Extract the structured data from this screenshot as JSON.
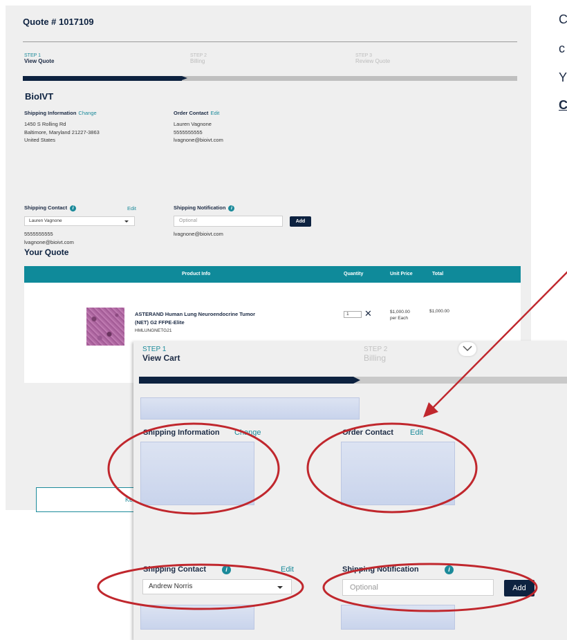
{
  "quote": {
    "title": "Quote # 1017109",
    "steps": [
      {
        "num": "STEP 1",
        "label": "View Quote"
      },
      {
        "num": "STEP 2",
        "label": "Billing"
      },
      {
        "num": "STEP 3",
        "label": "Review Quote"
      }
    ],
    "company": "BioIVT",
    "shipping_info": {
      "heading": "Shipping Information",
      "link": "Change",
      "lines": [
        "1450 S Rolling Rd",
        "Baltimore, Maryland 21227-3863",
        "United States"
      ]
    },
    "order_contact": {
      "heading": "Order Contact",
      "link": "Edit",
      "lines": [
        "Lauren Vagnone",
        "5555555555",
        "lvagnone@bioivt.com"
      ]
    },
    "shipping_contact": {
      "heading": "Shipping Contact",
      "edit": "Edit",
      "selected": "Lauren Vagnone",
      "lines": [
        "5555555555",
        "lvagnone@bioivt.com"
      ]
    },
    "shipping_notification": {
      "heading": "Shipping Notification",
      "placeholder": "Optional",
      "add": "Add",
      "email": "lvagnone@bioivt.com"
    },
    "your_quote": "Your Quote",
    "table": {
      "headers": [
        "Product Info",
        "Quantity",
        "Unit Price",
        "Total"
      ],
      "row": {
        "name_line1": "ASTERAND Human Lung Neuroendocrine Tumor",
        "name_line2": "(NET) G2 FFPE-Elite",
        "sku": "HMLUNGNETG21",
        "quantity": "1",
        "unit_price": "$1,000.00",
        "unit_note": "per Each",
        "total": "$1,000.00"
      }
    },
    "keep_button": "Ke"
  },
  "zoom": {
    "steps": [
      {
        "num": "STEP 1",
        "label": "View Cart"
      },
      {
        "num": "STEP 2",
        "label": "Billing"
      }
    ],
    "shipping_info_heading": "Shipping Information",
    "shipping_info_link": "Change",
    "order_contact_heading": "Order Contact",
    "order_contact_link": "Edit",
    "shipping_contact_heading": "Shipping Contact",
    "shipping_contact_edit": "Edit",
    "shipping_contact_selected": "Andrew Norris",
    "shipping_notification_heading": "Shipping Notification",
    "notification_placeholder": "Optional",
    "add": "Add"
  },
  "side_text": {
    "line1": "C",
    "line2": "c",
    "line3": "Y",
    "line4": "C"
  },
  "colors": {
    "navy": "#0d2240",
    "teal": "#0f8a9a",
    "annotation_red": "#c0272d",
    "panel_bg": "#efefef"
  },
  "icons": [
    "info-icon",
    "chevron-down-icon",
    "remove-x-icon",
    "caret-down-icon"
  ]
}
